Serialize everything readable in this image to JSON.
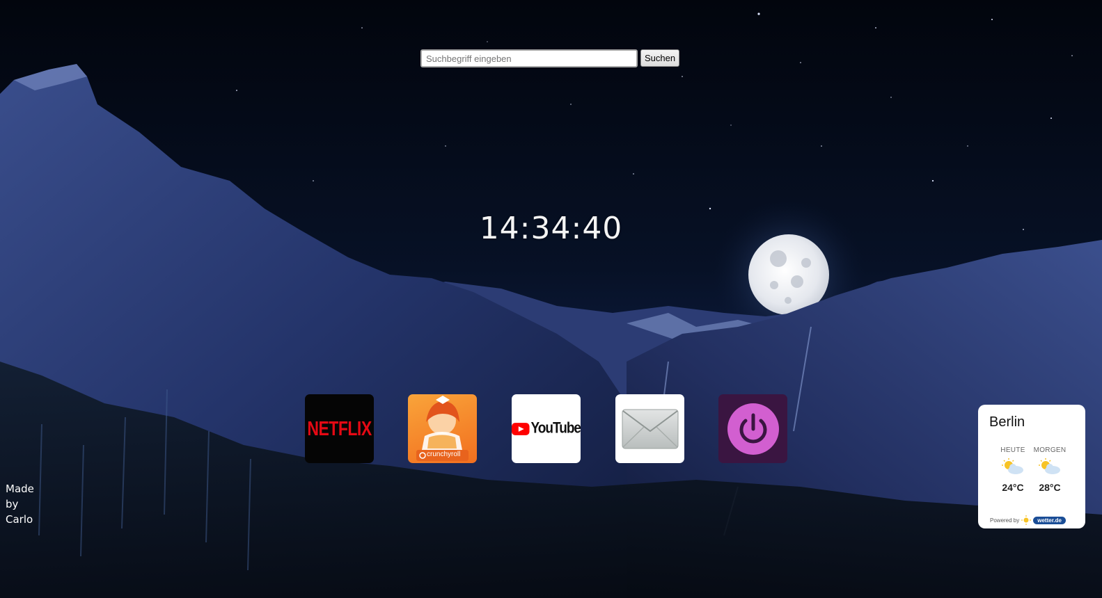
{
  "search": {
    "placeholder": "Suchbegriff eingeben",
    "value": "",
    "button_label": "Suchen"
  },
  "clock": {
    "time": "14:34:40"
  },
  "apps": [
    {
      "name": "Netflix",
      "label": "NETFLIX",
      "color": "#e50914"
    },
    {
      "name": "Crunchyroll",
      "label": "crunchyroll",
      "color": "#f47521"
    },
    {
      "name": "YouTube",
      "label": "YouTube",
      "color": "#ff0000"
    },
    {
      "name": "Mail",
      "icon": "envelope-icon"
    },
    {
      "name": "Power",
      "icon": "power-icon",
      "color": "#d25fd0"
    }
  ],
  "credit": {
    "line1": "Made",
    "line2": "by",
    "line3": "Carlo"
  },
  "weather": {
    "city": "Berlin",
    "days": [
      {
        "label": "HEUTE",
        "icon": "sun-cloud-icon",
        "temp": "24°C"
      },
      {
        "label": "MORGEN",
        "icon": "sun-cloud-icon",
        "temp": "28°C"
      }
    ],
    "powered_by": "Powered by",
    "provider": "wetter.de"
  }
}
